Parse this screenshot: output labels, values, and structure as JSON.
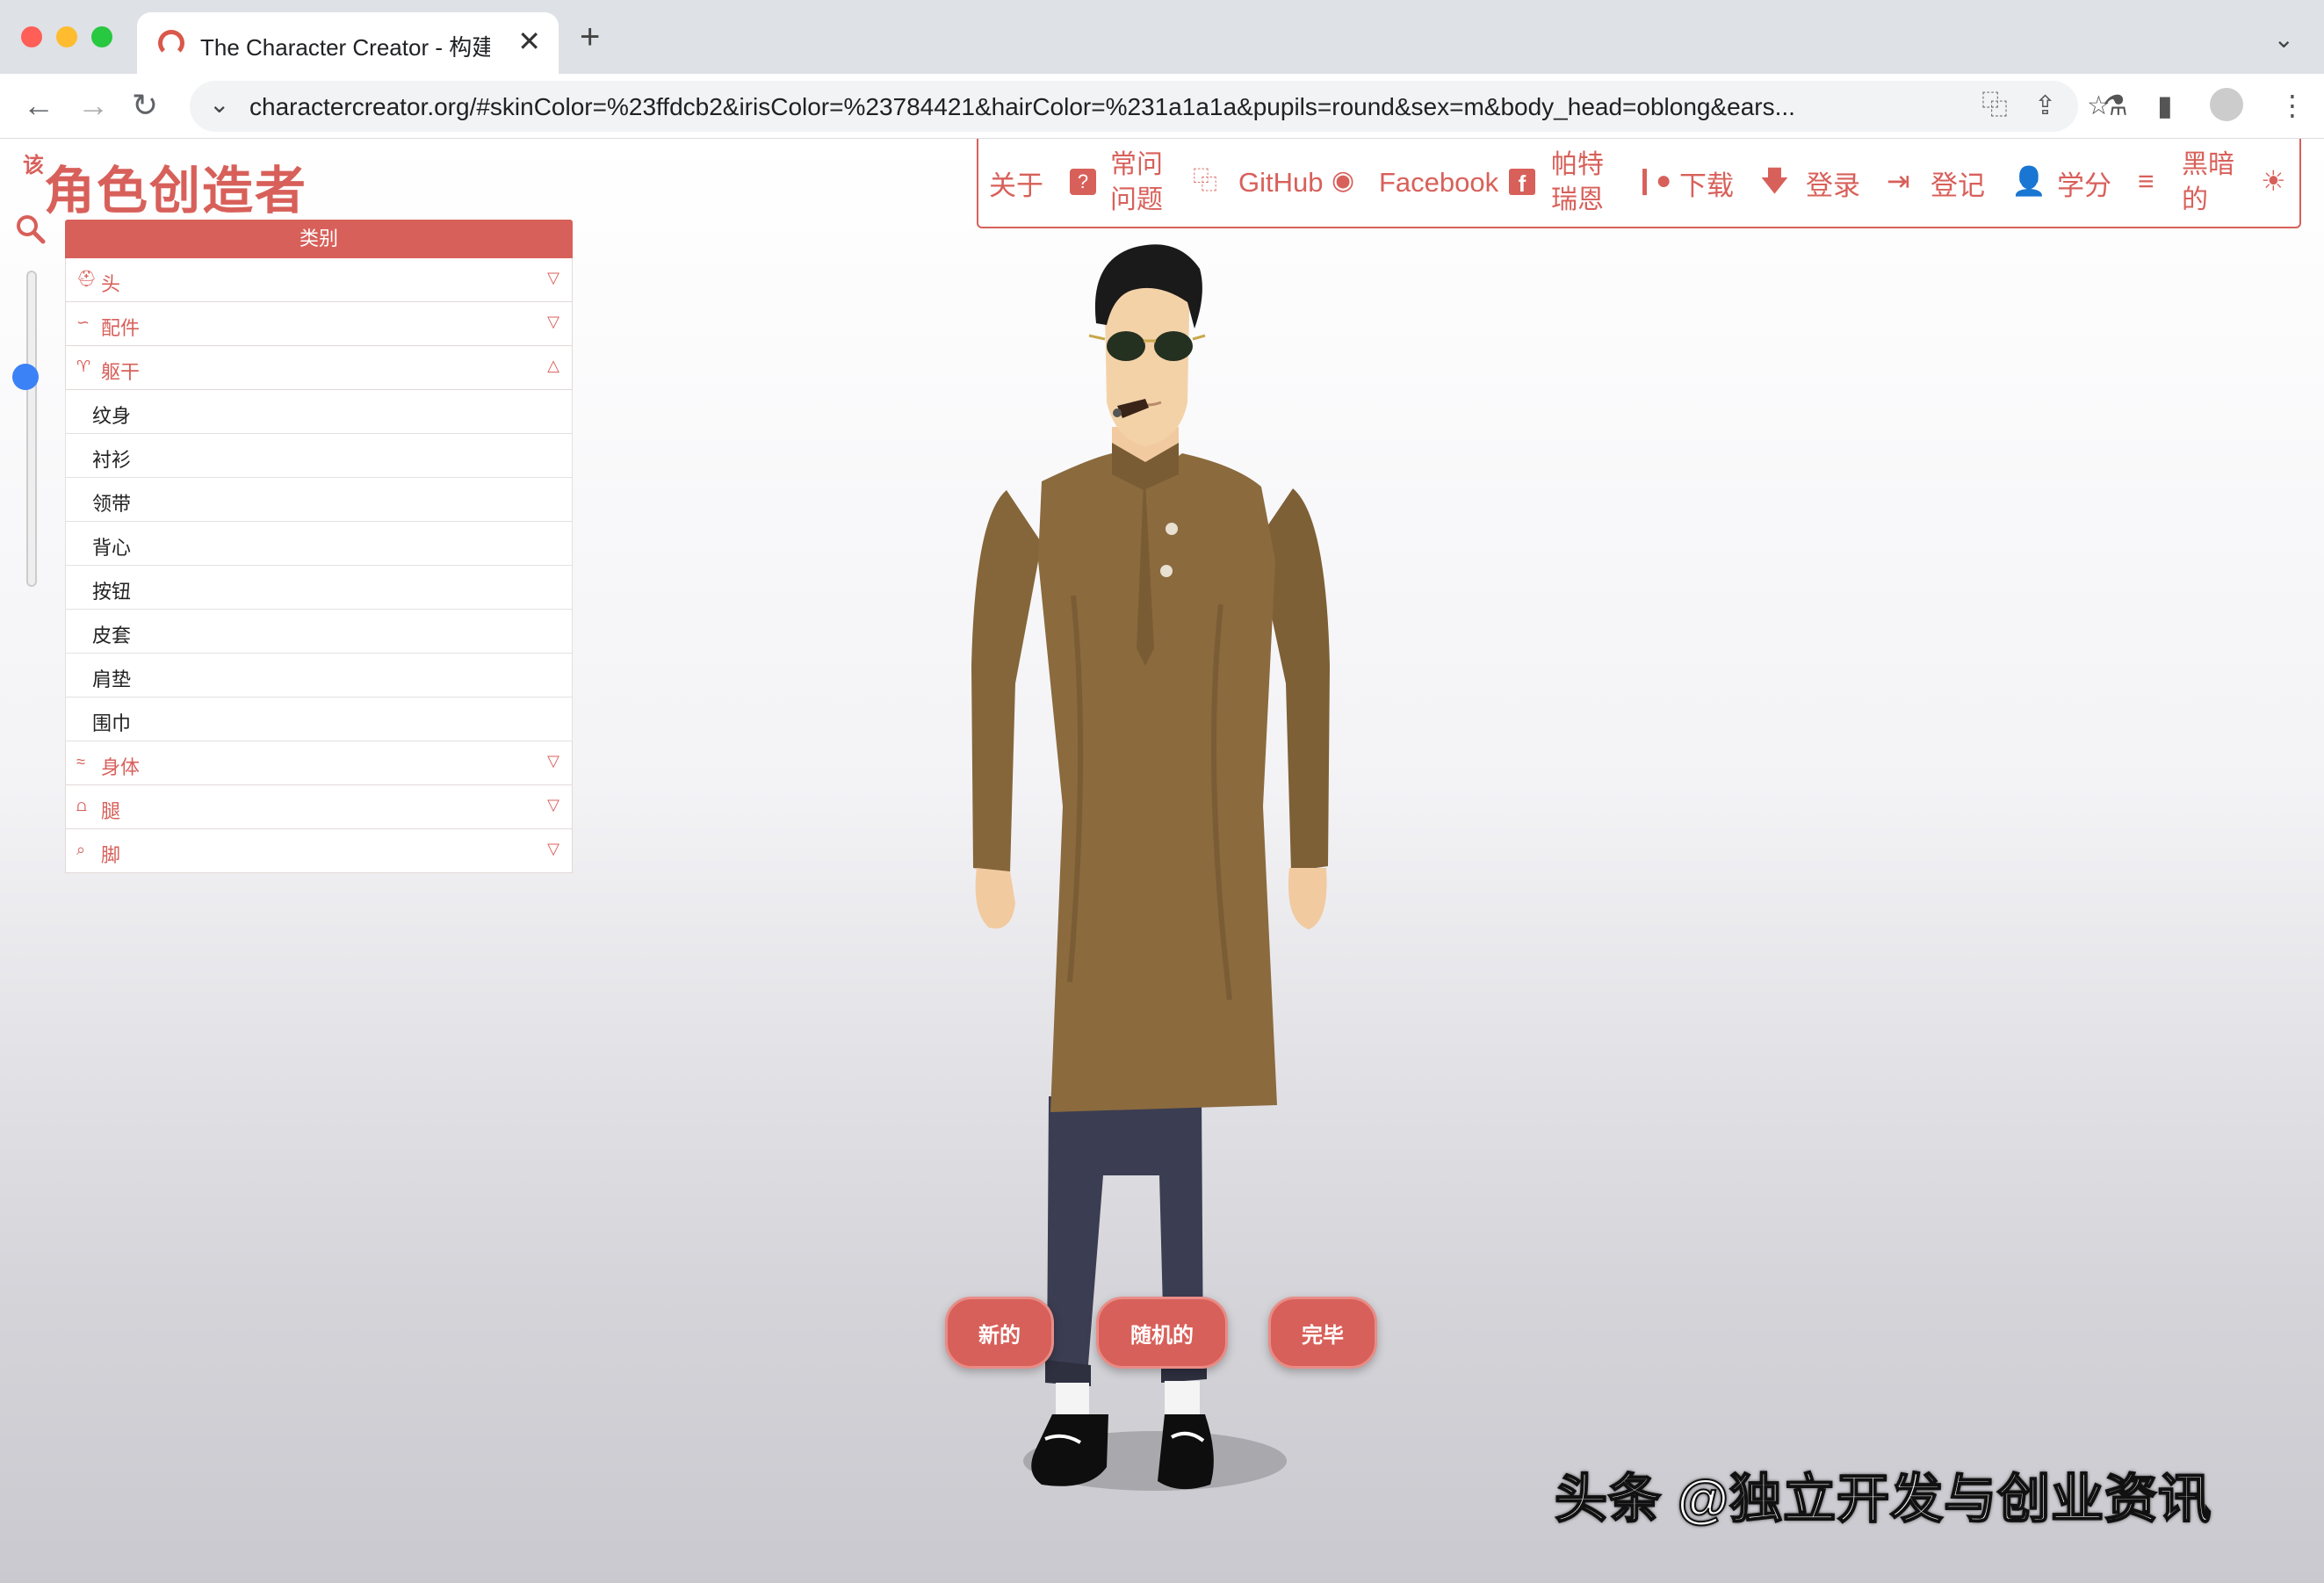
{
  "browser": {
    "tab_title": "The Character Creator - 构建视",
    "url": "charactercreator.org/#skinColor=%23ffdcb2&irisColor=%23784421&hairColor=%231a1a1a&pupils=round&sex=m&body_head=oblong&ears..."
  },
  "site": {
    "brand_small": "该",
    "brand": "角色创造者",
    "panel_header": "类别",
    "categories_top": [
      {
        "label": "头",
        "icon": "head-icon"
      },
      {
        "label": "配件",
        "icon": "accessories-icon"
      },
      {
        "label": "躯干",
        "icon": "torso-icon"
      }
    ],
    "torso_items": [
      "纹身",
      "衬衫",
      "领带",
      "背心",
      "按钮",
      "皮套",
      "肩垫",
      "围巾"
    ],
    "categories_bottom": [
      {
        "label": "身体",
        "icon": "body-icon"
      },
      {
        "label": "腿",
        "icon": "legs-icon"
      },
      {
        "label": "脚",
        "icon": "feet-icon"
      }
    ],
    "nav": {
      "about": "关于",
      "faq": "常问问题",
      "github": "GitHub",
      "facebook": "Facebook",
      "patreon": "帕特瑞恩",
      "download": "下载",
      "login": "登录",
      "register": "登记",
      "credits": "学分",
      "dark": "黑暗的"
    },
    "buttons": {
      "new": "新的",
      "random": "随机的",
      "done": "完毕"
    }
  },
  "watermark": "头条 @独立开发与创业资讯",
  "colors": {
    "accent": "#d8605a",
    "shirt": "#8b6a3e",
    "jeans": "#3b3d52",
    "skin": "#ffdcb2",
    "hair": "#1a1a1a"
  }
}
